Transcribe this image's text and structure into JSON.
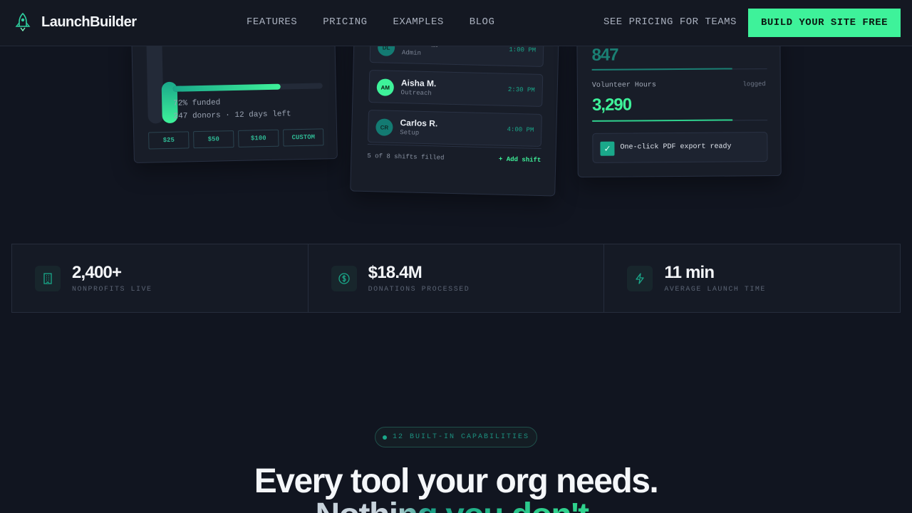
{
  "nav": {
    "brand": "LaunchBuilder",
    "links": [
      "FEATURES",
      "PRICING",
      "EXAMPLES",
      "BLOG"
    ],
    "teams_link": "SEE PRICING FOR TEAMS",
    "cta": "BUILD YOUR SITE FREE"
  },
  "fundraiser": {
    "funded_fraction": 0.72,
    "funded_text": "72% funded",
    "donors_text": "247 donors · 12 days left",
    "amounts": [
      "$25",
      "$50",
      "$100",
      "CUSTOM"
    ]
  },
  "shifts": {
    "items": [
      {
        "initials": "DL",
        "name": "Devon L.",
        "role": "Admin",
        "time": "1:00 PM"
      },
      {
        "initials": "AM",
        "name": "Aisha M.",
        "role": "Outreach",
        "time": "2:30 PM"
      },
      {
        "initials": "CR",
        "name": "Carlos R.",
        "role": "Setup",
        "time": "4:00 PM"
      }
    ],
    "filled_text": "5 of 8 shifts filled",
    "add_label": "+ Add shift"
  },
  "metrics": {
    "top_value": "847",
    "hours_label": "Volunteer Hours",
    "hours_tag": "logged",
    "hours_value": "3,290",
    "export_text": "One-click PDF export ready"
  },
  "stats": [
    {
      "value": "2,400+",
      "label": "NONPROFITS LIVE",
      "icon": "building-icon"
    },
    {
      "value": "$18.4M",
      "label": "DONATIONS PROCESSED",
      "icon": "dollar-coin-icon"
    },
    {
      "value": "11 min",
      "label": "AVERAGE LAUNCH TIME",
      "icon": "lightning-icon"
    }
  ],
  "section": {
    "pill": "12 BUILT-IN CAPABILITIES",
    "headline": "Every tool your org needs.",
    "subline": "Nothing you don't."
  },
  "colors": {
    "background": "#111520",
    "accent": "#3ef29a",
    "teal": "#1aa88a"
  }
}
